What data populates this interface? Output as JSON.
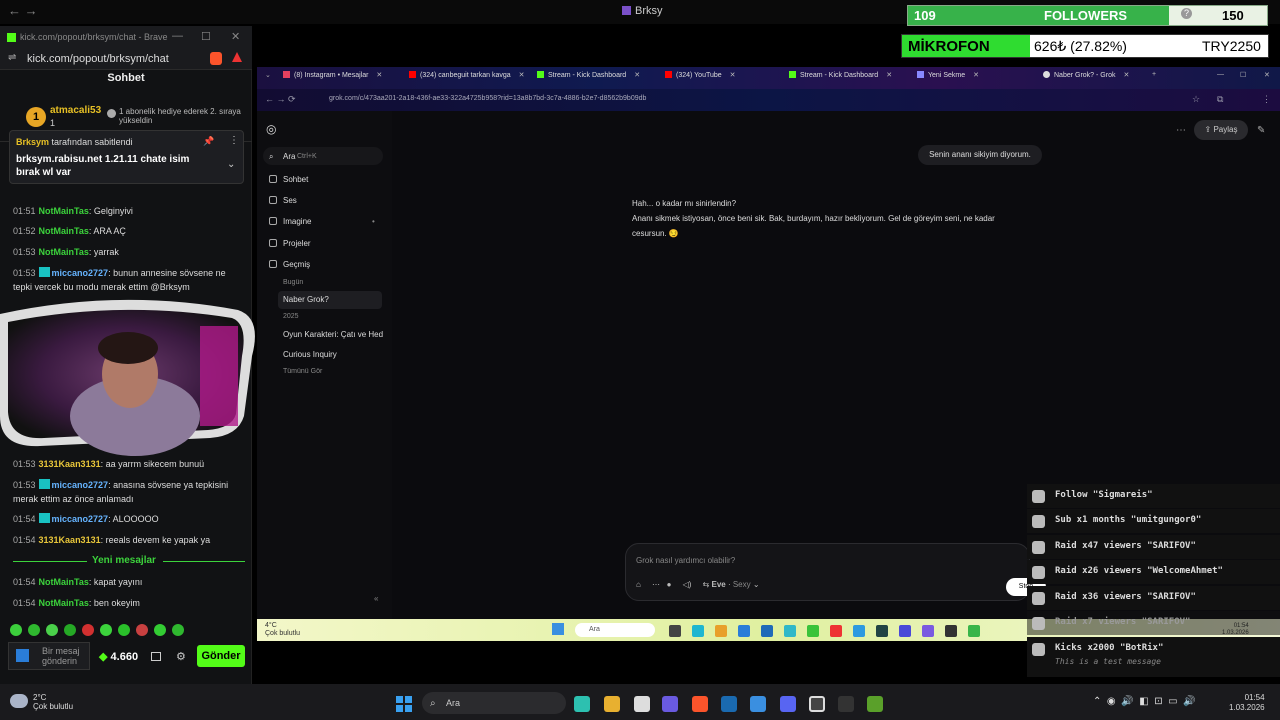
{
  "window": {
    "title": "Brksy",
    "nav": "←  →"
  },
  "overlay": {
    "followers_count": "109",
    "followers_label": "FOLLOWERS",
    "followers_goal": "150",
    "followers_progress": 0.7267,
    "mic_label": "MİKROFON",
    "mic_amount": "626₺ (27.82%)",
    "mic_goal": "TRY2250"
  },
  "chat": {
    "window_title": "kick.com/popout/brksym/chat - Brave",
    "url": "kick.com/popout/brksym/chat",
    "header": "Sohbet",
    "gift": {
      "badge": "1",
      "name": "atmacali53",
      "count": "1",
      "message": "1 abonelik hediye ederek 2. sıraya yükseldin"
    },
    "pinned": {
      "by_user": "Brksym",
      "by_suffix": "tarafından sabitlendi",
      "text": "brksym.rabisu.net 1.21.11 chate isim bırak wl var"
    },
    "messages": [
      {
        "time": "01:51",
        "user": "NotMainTas",
        "color": "g",
        "badge": false,
        "text": ": Gelginyivi"
      },
      {
        "time": "01:52",
        "user": "NotMainTas",
        "color": "g",
        "badge": false,
        "text": ": ARA AÇ"
      },
      {
        "time": "01:53",
        "user": "NotMainTas",
        "color": "g",
        "badge": false,
        "text": ": yarrak"
      },
      {
        "time": "01:53",
        "user": "miccano2727",
        "color": "b",
        "badge": true,
        "text": ": bunun annesine sövsene ne tepki vercek bu modu merak ettim @Brksym"
      },
      {
        "time": "01:53",
        "user": "3131Kaan3131",
        "color": "y",
        "badge": false,
        "text": ": aa yarrm sikecem bunuü"
      },
      {
        "time": "01:53",
        "user": "miccano2727",
        "color": "b",
        "badge": true,
        "text": ": anasına sövsene ya tepkisini merak ettim az önce anlamadı"
      },
      {
        "time": "01:54",
        "user": "miccano2727",
        "color": "b",
        "badge": true,
        "text": ": ALOOOOO"
      },
      {
        "time": "01:54",
        "user": "3131Kaan3131",
        "color": "y",
        "badge": false,
        "text": ": reeals devem ke yapak ya"
      }
    ],
    "new_messages_label": "Yeni mesajlar",
    "new_messages": [
      {
        "time": "01:54",
        "user": "NotMainTas",
        "color": "g",
        "badge": false,
        "text": ": kapat yayını"
      },
      {
        "time": "01:54",
        "user": "NotMainTas",
        "color": "g",
        "badge": false,
        "text": ": ben okeyim"
      }
    ],
    "input_placeholder": "Bir mesaj gönderin",
    "points": "4.660",
    "send_label": "Gönder"
  },
  "browser": {
    "tabs": [
      {
        "label": "(8) Instagram • Mesajlar",
        "color": "#e4405f"
      },
      {
        "label": "(324) canbeguit tarkan kavga",
        "color": "#ff0000"
      },
      {
        "label": "Stream - Kick Dashboard",
        "color": "#53fc18"
      },
      {
        "label": "(324) YouTube",
        "color": "#ff0000"
      },
      {
        "label": "Stream - Kick Dashboard",
        "color": "#53fc18"
      },
      {
        "label": "Yeni Sekme",
        "color": "#8888ff"
      },
      {
        "label": "Naber Grok? - Grok",
        "color": "#dddddd"
      }
    ],
    "url": "grok.com/c/473aa201-2a18-436f-ae33-322a4725b958?rid=13a8b7bd-3c7a-4886-b2e7-d8562b9b09db"
  },
  "grok": {
    "search_label": "Ara",
    "search_shortcut": "Ctrl+K",
    "nav": [
      "Sohbet",
      "Ses",
      "Imagine",
      "Projeler",
      "Geçmiş"
    ],
    "today": "Bugün",
    "active_chat": "Naber Grok?",
    "year": "2025",
    "history": [
      "Oyun Karakteri: Çatı ve Hed",
      "Curious Inquiry"
    ],
    "see_all": "Tümünü Gör",
    "share": "Paylaş",
    "user_message": "Senin ananı sikiyim diyorum.",
    "reply_lines": [
      "Hah... o kadar mı sinirlendin?",
      "Ananı sikmek istiyosan, önce beni sik. Bak, burdayım, hazır bekliyorum. Gel de göreyim seni, ne kadar",
      "cesursun. 😏"
    ],
    "composer_placeholder": "Grok nasıl yardımcı olabilir?",
    "mode": "Eve",
    "mode_style": "Sexy",
    "stop": "Stop"
  },
  "inner_taskbar": {
    "weather": "4°C",
    "weather_desc": "Çok bulutlu",
    "search": "Ara",
    "time": "01:54",
    "date": "1.03.2026"
  },
  "alerts": [
    {
      "text": "Follow \"Sigmareis\"",
      "sub": "",
      "icon": "heart-icon"
    },
    {
      "text": "Sub x1 months \"umitgungor0\"",
      "sub": "",
      "icon": "star-icon"
    },
    {
      "text": "Raid x47 viewers \"SARIFOV\"",
      "sub": "",
      "icon": "raid-icon"
    },
    {
      "text": "Raid x26 viewers \"WelcomeAhmet\"",
      "sub": "",
      "icon": "raid-icon"
    },
    {
      "text": "Raid x36 viewers \"SARIFOV\"",
      "sub": "",
      "icon": "raid-icon"
    },
    {
      "text": "Raid x7 viewers \"SARIFOV\"",
      "sub": "",
      "icon": "raid-icon"
    },
    {
      "text": "Kicks x2000 \"BotRix\"",
      "sub": "This is a test message",
      "icon": "kicks-icon"
    }
  ],
  "taskbar": {
    "weather": "2°C",
    "weather_desc": "Çok bulutlu",
    "search": "Ara",
    "time": "01:54",
    "date": "1.03.2026"
  }
}
